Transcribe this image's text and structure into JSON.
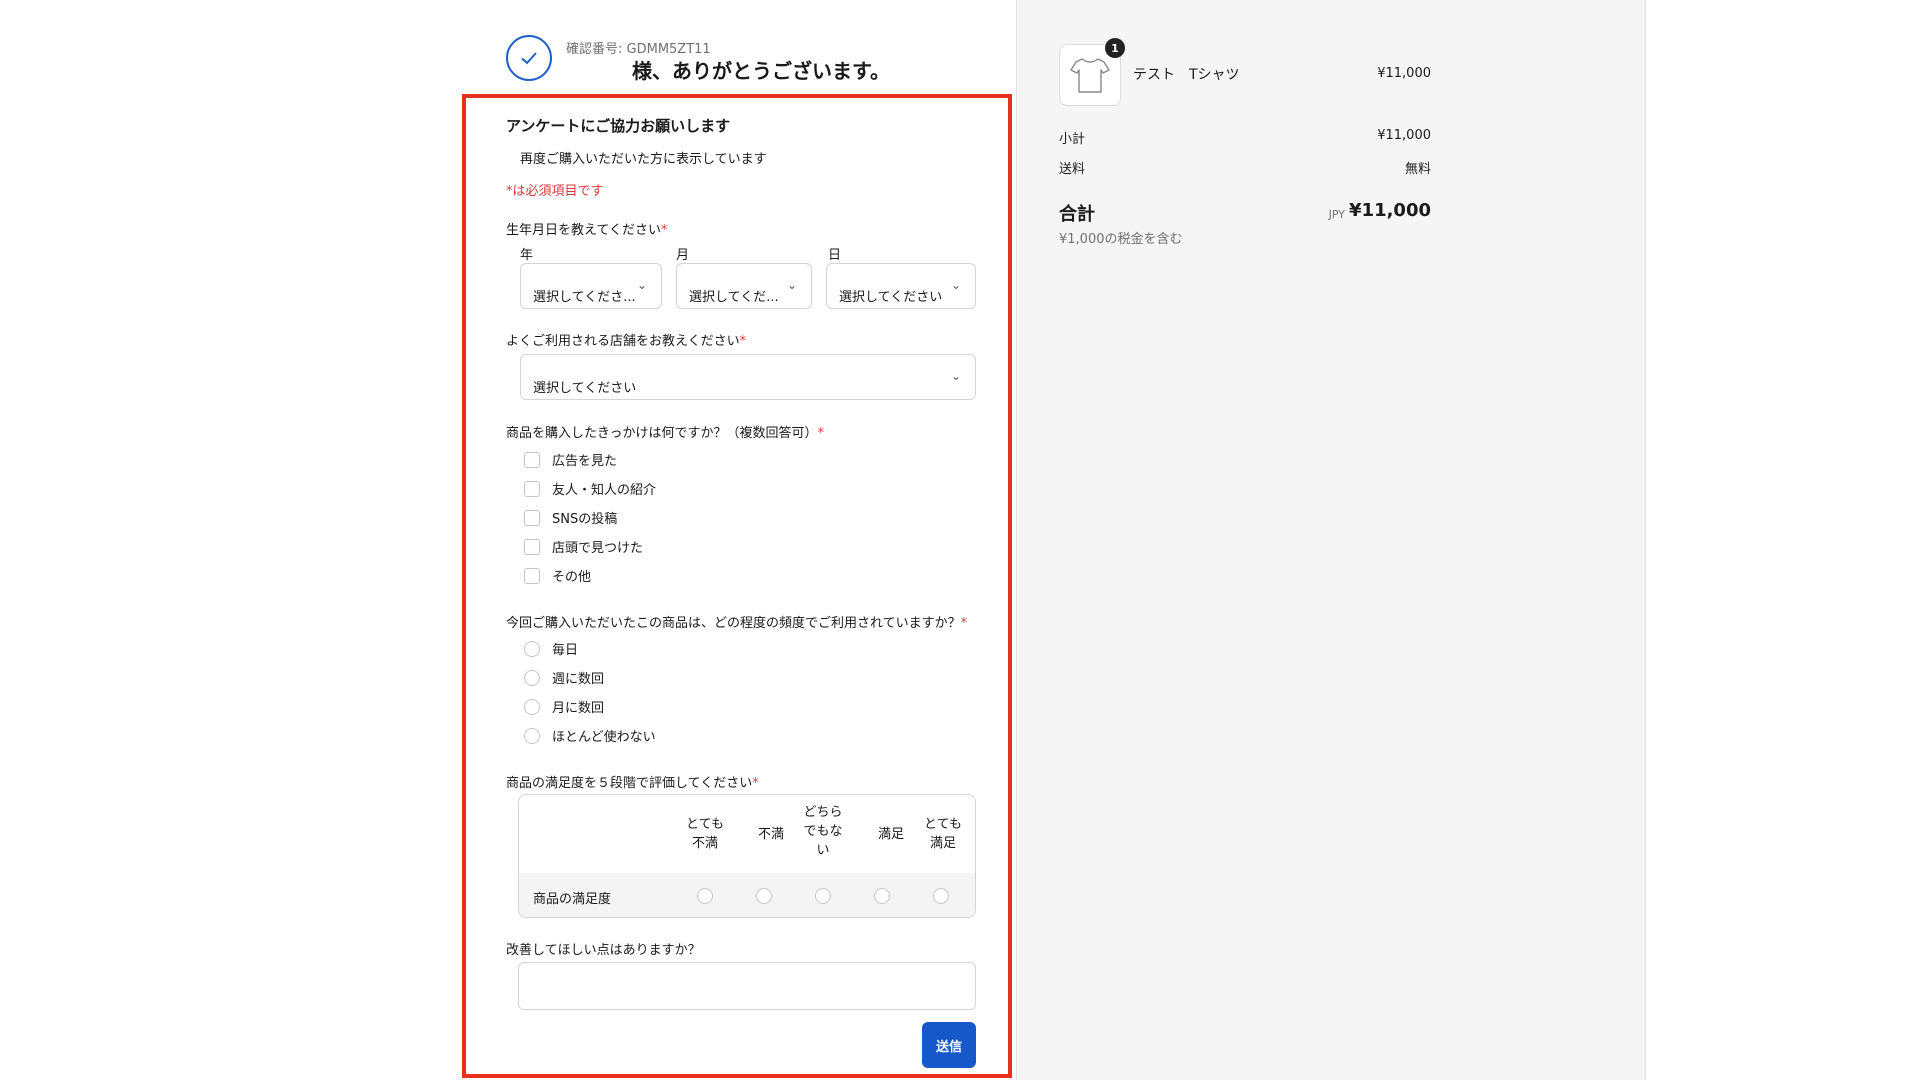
{
  "header": {
    "confirmation_number": "確認番号: GDMM5ZT11",
    "thanks_message": "様、ありがとうございます。"
  },
  "survey": {
    "title": "アンケートにご協力お願いします",
    "subtitle": "再度ご購入いただいた方に表示しています",
    "required_note": "*は必須項目です",
    "birthdate": {
      "label": "生年月日を教えてください",
      "year_label": "年",
      "month_label": "月",
      "day_label": "日",
      "year_value": "選択してくださ...",
      "month_value": "選択してくだ...",
      "day_value": "選択してください"
    },
    "store": {
      "label": "よくご利用される店舗をお教えください",
      "value": "選択してください"
    },
    "reason": {
      "label": "商品を購入したきっかけは何ですか？（複数回答可）",
      "options": [
        "広告を見た",
        "友人・知人の紹介",
        "SNSの投稿",
        "店頭で見つけた",
        "その他"
      ]
    },
    "frequency": {
      "label": "今回ご購入いただいたこの商品は、どの程度の頻度でご利用されていますか？",
      "options": [
        "毎日",
        "週に数回",
        "月に数回",
        "ほとんど使わない"
      ]
    },
    "satisfaction": {
      "label": "商品の満足度を５段階で評価してください",
      "columns": [
        "とても\n不満",
        "不満",
        "どちら\nでもな\nい",
        "満足",
        "とても\n満足"
      ],
      "row_label": "商品の満足度"
    },
    "improvement": {
      "label": "改善してほしい点はありますか？"
    },
    "submit_label": "送信",
    "required_mark": "*"
  },
  "order_summary": {
    "item": {
      "name": "テスト　Tシャツ",
      "price": "¥11,000",
      "quantity": "1",
      "icon": "tshirt-icon"
    },
    "subtotal_label": "小計",
    "subtotal_value": "¥11,000",
    "shipping_label": "送料",
    "shipping_value": "無料",
    "total_label": "合計",
    "currency": "JPY",
    "total_value": "¥11,000",
    "tax_note": "¥1,000の税金を含む"
  },
  "colors": {
    "accent_blue": "#1658c9",
    "required_red": "#d83a3a",
    "highlight_red": "#e8321e"
  }
}
